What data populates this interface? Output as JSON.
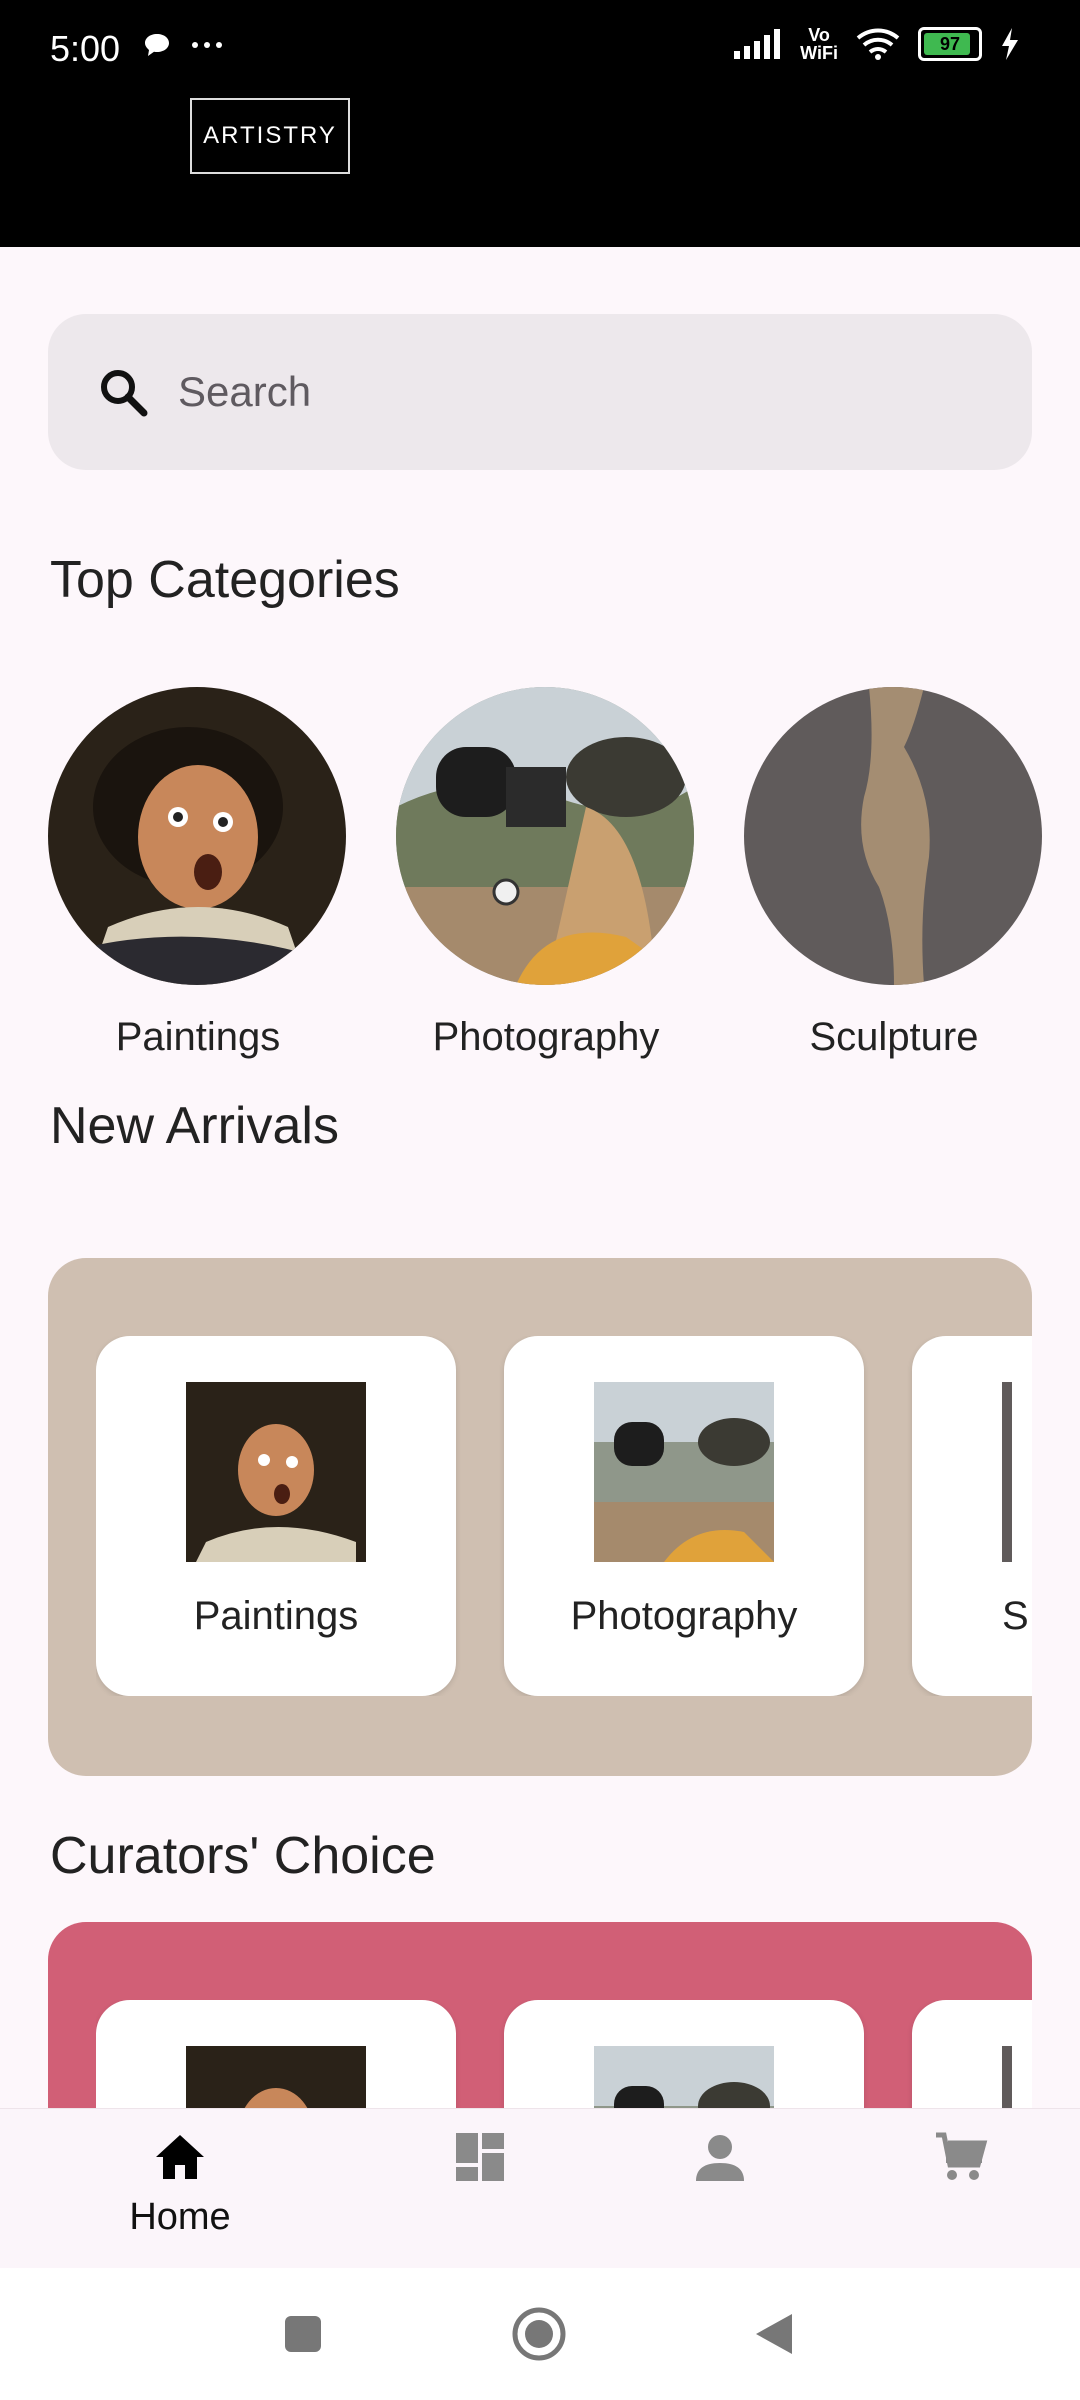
{
  "status": {
    "time": "5:00",
    "left_icons": "chat-bubble-icon more-dots-icon",
    "battery": "97",
    "network": "Vo WiFi"
  },
  "header": {
    "logo_text": "ARTISTRY"
  },
  "search": {
    "placeholder": "Search"
  },
  "sections": {
    "top_categories": "Top Categories",
    "new_arrivals": "New Arrivals",
    "curators_choice": "Curators' Choice"
  },
  "categories": [
    {
      "label": "Paintings",
      "icon": "painting-portrait"
    },
    {
      "label": "Photography",
      "icon": "photographer"
    },
    {
      "label": "Sculpture",
      "icon": "sculpture"
    }
  ],
  "new_arrivals": {
    "bg_color": "#cfbfb1",
    "cards": [
      {
        "label": "Paintings"
      },
      {
        "label": "Photography"
      },
      {
        "label": "S"
      }
    ]
  },
  "curators_choice": {
    "bg_color": "#d15f76",
    "cards": [
      {
        "label": "Paintings"
      },
      {
        "label": "Photography"
      },
      {
        "label": ""
      }
    ]
  },
  "bottom_nav": {
    "items": [
      {
        "label": "Home",
        "icon": "home-icon",
        "active": true
      },
      {
        "label": "",
        "icon": "dashboard-icon",
        "active": false
      },
      {
        "label": "",
        "icon": "person-icon",
        "active": false
      },
      {
        "label": "",
        "icon": "cart-icon",
        "active": false
      }
    ]
  },
  "colors": {
    "accent": "#000000",
    "page_bg": "#fdf7fb"
  }
}
